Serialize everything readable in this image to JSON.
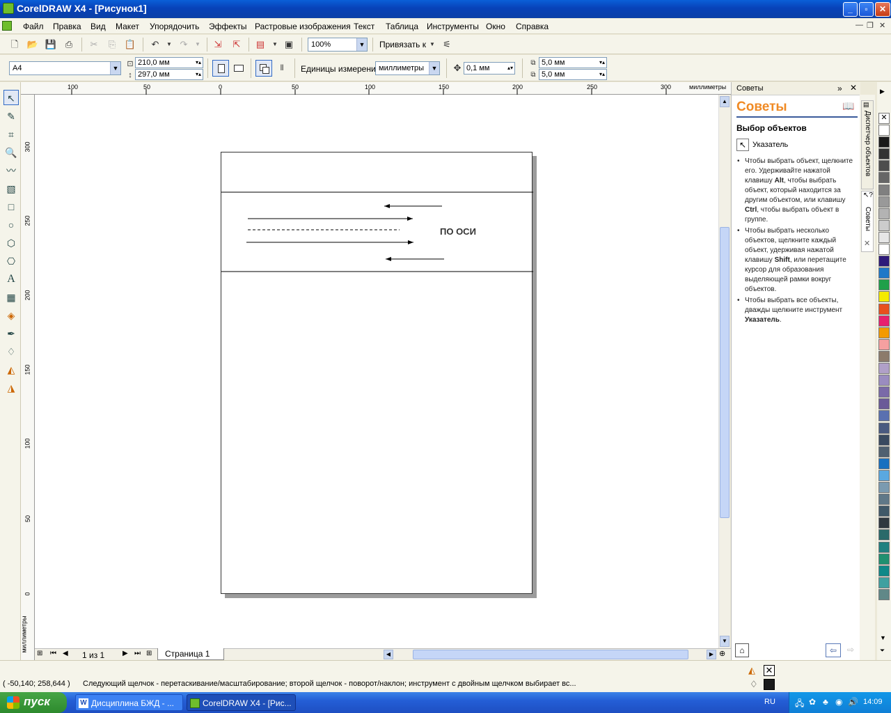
{
  "window": {
    "title": "CorelDRAW X4 - [Рисунок1]"
  },
  "menu": [
    "Файл",
    "Правка",
    "Вид",
    "Макет",
    "Упорядочить",
    "Эффекты",
    "Растровые изображения",
    "Текст",
    "Таблица",
    "Инструменты",
    "Окно",
    "Справка"
  ],
  "toolbar": {
    "zoom": "100%",
    "snap_label": "Привязать к"
  },
  "property_bar": {
    "page_size": "A4",
    "width": "210,0 мм",
    "height": "297,0 мм",
    "units_label": "Единицы измерения:",
    "units_value": "миллиметры",
    "nudge": "0,1 мм",
    "dup_x": "5,0 мм",
    "dup_y": "5,0 мм"
  },
  "ruler": {
    "units": "миллиметры",
    "top_labels": [
      "100",
      "50",
      "0",
      "50",
      "100",
      "150",
      "200",
      "250",
      "300"
    ],
    "left_labels": [
      "300",
      "250",
      "200",
      "150",
      "100",
      "50",
      "0"
    ]
  },
  "drawing": {
    "text": "ПО ОСИ"
  },
  "page_nav": {
    "counter": "1 из 1",
    "tab": "Страница 1"
  },
  "docker": {
    "header": "Советы",
    "title": "Советы",
    "subtitle": "Выбор объектов",
    "tool_name": "Указатель",
    "tips": [
      {
        "parts": [
          [
            "Чтобы выбрать объект, щелкните его. Удерживайте нажатой клавишу ",
            false
          ],
          [
            "Alt",
            true
          ],
          [
            ", чтобы выбрать объект, который находится за другим объектом, или клавишу ",
            false
          ],
          [
            "Ctrl",
            true
          ],
          [
            ", чтобы выбрать объект в группе.",
            false
          ]
        ]
      },
      {
        "parts": [
          [
            "Чтобы выбрать несколько объектов, щелкните каждый объект, удерживая нажатой клавишу ",
            false
          ],
          [
            "Shift",
            true
          ],
          [
            ", или перетащите курсор для образования выделяющей рамки вокруг объектов.",
            false
          ]
        ]
      },
      {
        "parts": [
          [
            "Чтобы выбрать все объекты, дважды щелкните инструмент ",
            false
          ],
          [
            "Указатель",
            true
          ],
          [
            ".",
            false
          ]
        ]
      }
    ],
    "side_tabs": [
      "Диспетчер объектов",
      "Советы"
    ]
  },
  "palette": [
    "#ffffff",
    "#1a1a1a",
    "#333333",
    "#4d4d4d",
    "#666666",
    "#808080",
    "#999999",
    "#b3b3b3",
    "#cccccc",
    "#e6e6e6",
    "#ffffff",
    "#2e1a7a",
    "#1f78c8",
    "#1fa04a",
    "#f5eb00",
    "#e8501e",
    "#e8206e",
    "#f39a00",
    "#f5a0a0",
    "#8c7b6b",
    "#b0a0c8",
    "#9a8cc0",
    "#7a6aa8",
    "#6a5a98",
    "#5a70b0",
    "#4a5a80",
    "#3a4a60",
    "#506070",
    "#1870c0",
    "#5aa8e0",
    "#7a9ab0",
    "#607888",
    "#405868",
    "#303840",
    "#2a6a6a",
    "#208080",
    "#209070",
    "#108888",
    "#40a0a0",
    "#608888"
  ],
  "status": {
    "coords": "( -50,140; 258,644 )",
    "message": "Следующий щелчок - перетаскивание/масштабирование; второй щелчок - поворот/наклон; инструмент с двойным щелчком выбирает вс..."
  },
  "taskbar": {
    "start": "пуск",
    "tasks": [
      "Дисциплина БЖД - ...",
      "CorelDRAW X4 - [Рис..."
    ],
    "lang": "RU",
    "clock": "14:09"
  }
}
